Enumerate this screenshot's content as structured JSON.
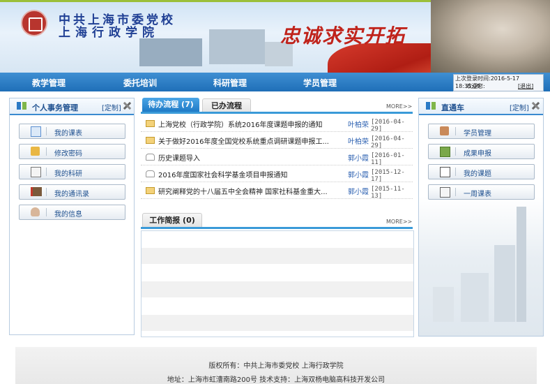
{
  "header": {
    "school_line1": "中共上海市委党校",
    "school_line2": "上海行政学院",
    "slogan": "忠诚求实开拓"
  },
  "nav": {
    "items": [
      "教学管理",
      "委托培训",
      "科研管理",
      "学员管理"
    ]
  },
  "login": {
    "last_login": "上次登录时间:2016-5-17 18:35:09",
    "welcome": "欢迎您:",
    "logout": "[退出]"
  },
  "left_panel": {
    "title": "个人事务管理",
    "custom": "[定制]",
    "items": [
      "我的课表",
      "修改密码",
      "我的科研",
      "我的通讯录",
      "我的信息"
    ]
  },
  "right_panel": {
    "title": "直通车",
    "custom": "[定制]",
    "items": [
      "学员管理",
      "成果申报",
      "我的课题",
      "一周课表"
    ]
  },
  "todo": {
    "tab_active": "待办流程 (7)",
    "tab_inactive": "已办流程",
    "more": "MORE>>",
    "rows": [
      {
        "title": "上海党校（行政学院）系统2016年度课题申报的通知",
        "name": "叶柏荣",
        "date": "[2016-04-29]",
        "status": "unread"
      },
      {
        "title": "关于做好2016年度全国党校系统重点调研课题申报工...",
        "name": "叶柏荣",
        "date": "[2016-04-29]",
        "status": "unread"
      },
      {
        "title": "历史课题导入",
        "name": "郭小霞",
        "date": "[2016-01-11]",
        "status": "read"
      },
      {
        "title": "2016年度国家社会科学基金项目申报通知",
        "name": "郭小霞",
        "date": "[2015-12-17]",
        "status": "read"
      },
      {
        "title": "研究阐释党的十八届五中全会精神 国家社科基金重大...",
        "name": "郭小霞",
        "date": "[2015-11-13]",
        "status": "unread"
      }
    ]
  },
  "brief": {
    "tab": "工作简报 (0)",
    "more": "MORE>>"
  },
  "footer": {
    "copyright": "版权所有：中共上海市委党校  上海行政学院",
    "address": "地址：上海市虹漕南路200号  技术支持：上海双杨电脑高科技开发公司"
  },
  "colors": {
    "nav_blue": "#1f6fb8",
    "tab_blue": "#3a9ad8",
    "link_blue": "#2a5fb0",
    "slogan_red": "#c0231b"
  }
}
